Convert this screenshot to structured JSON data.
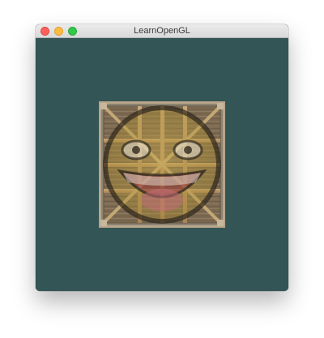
{
  "window": {
    "title": "LearnOpenGL",
    "clear_color": "#335555",
    "controls": [
      "close-button",
      "minimize-button",
      "maximize-button"
    ]
  },
  "scene": {
    "object": "textured-quad",
    "textures": [
      "wooden-container",
      "awesome-face"
    ],
    "blend": "mix"
  }
}
